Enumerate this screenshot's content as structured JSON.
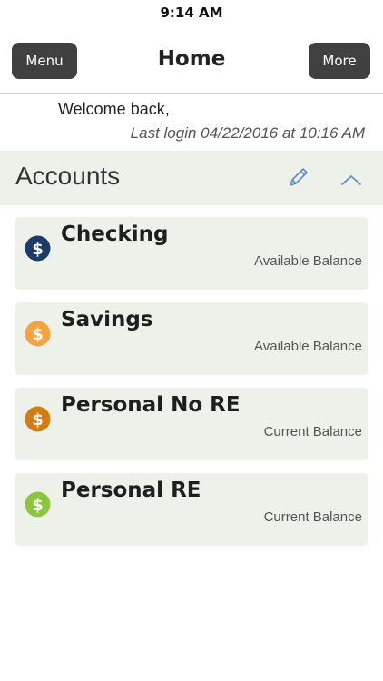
{
  "status_bar": {
    "time": "9:14 AM"
  },
  "nav": {
    "menu_label": "Menu",
    "title": "Home",
    "more_label": "More"
  },
  "welcome": {
    "greeting": "Welcome back,",
    "last_login": "Last login 04/22/2016 at 10:16 AM"
  },
  "accounts": {
    "title": "Accounts",
    "edit_icon": "pencil-icon",
    "collapse_icon": "chevron-up-icon",
    "accent_color": "#5b8fc9",
    "items": [
      {
        "name": "Checking",
        "balance_label": "Available Balance",
        "icon_color": "#1c3c66",
        "icon": "dollar-coin-icon"
      },
      {
        "name": "Savings",
        "balance_label": "Available Balance",
        "icon_color": "#f4a341",
        "icon": "dollar-coin-icon"
      },
      {
        "name": "Personal No RE",
        "balance_label": "Current Balance",
        "icon_color": "#d47c14",
        "icon": "dollar-coin-icon"
      },
      {
        "name": "Personal RE",
        "balance_label": "Current Balance",
        "icon_color": "#8cc63f",
        "icon": "dollar-coin-icon"
      }
    ]
  }
}
